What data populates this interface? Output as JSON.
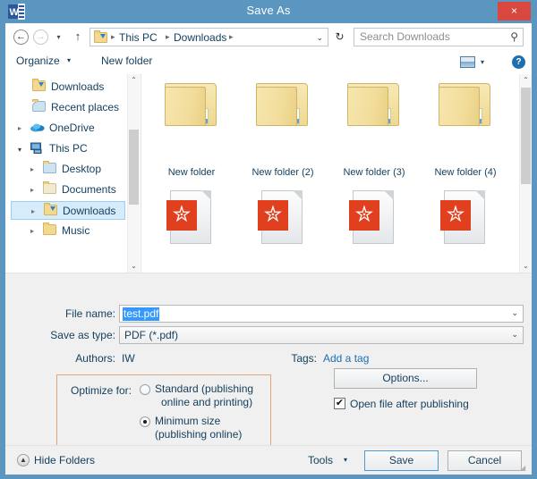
{
  "window": {
    "title": "Save As",
    "app_icon": "word-icon",
    "close_label": "×",
    "titlebar_color": "#5b96c0",
    "close_color": "#d9483e"
  },
  "navbar": {
    "back_glyph": "←",
    "forward_glyph": "→",
    "recent_glyph": "▾",
    "up_glyph": "↑",
    "breadcrumb": [
      "This PC",
      "Downloads"
    ],
    "breadcrumb_sep": "▸",
    "breadcrumb_caret": "⌄",
    "refresh_glyph": "↻",
    "search_placeholder": "Search Downloads",
    "search_value": "",
    "search_icon": "⚲"
  },
  "commandbar": {
    "organize_label": "Organize",
    "organize_caret": "▾",
    "new_folder_label": "New folder",
    "view_caret": "▾",
    "help_label": "?"
  },
  "sidebar": {
    "items": [
      {
        "label": "Downloads",
        "icon": "folder-downloads-icon",
        "indent": 24,
        "expander": "",
        "selected": false
      },
      {
        "label": "Recent places",
        "icon": "recent-places-icon",
        "indent": 24,
        "expander": "",
        "selected": false
      },
      {
        "label": "OneDrive",
        "icon": "onedrive-icon",
        "indent": 22,
        "expander": "▸",
        "selected": false
      },
      {
        "label": "This PC",
        "icon": "this-pc-icon",
        "indent": 22,
        "expander": "▾",
        "selected": false
      },
      {
        "label": "Desktop",
        "icon": "folder-desktop-icon",
        "indent": 36,
        "expander": "▸",
        "selected": false
      },
      {
        "label": "Documents",
        "icon": "folder-documents-icon",
        "indent": 36,
        "expander": "▸",
        "selected": false
      },
      {
        "label": "Downloads",
        "icon": "folder-downloads-icon",
        "indent": 36,
        "expander": "▸",
        "selected": true
      },
      {
        "label": "Music",
        "icon": "folder-music-icon",
        "indent": 36,
        "expander": "▸",
        "selected": false
      }
    ],
    "scroll_up": "⌃",
    "scroll_down": "⌄"
  },
  "filelist": {
    "folders": [
      {
        "name": "New folder"
      },
      {
        "name": "New folder (2)"
      },
      {
        "name": "New folder (3)"
      },
      {
        "name": "New folder (4)"
      }
    ],
    "files": [
      {
        "name": "",
        "icon": "pdf-file-icon",
        "glyph": "✮"
      },
      {
        "name": "",
        "icon": "pdf-file-icon",
        "glyph": "✮"
      },
      {
        "name": "",
        "icon": "pdf-file-icon",
        "glyph": "✮"
      },
      {
        "name": "",
        "icon": "pdf-file-icon",
        "glyph": "✮"
      }
    ],
    "pdf_badge_color": "#e1401f",
    "scroll_up": "⌃",
    "scroll_down": "⌄"
  },
  "form": {
    "filename_label": "File name:",
    "filename_value": "test.pdf",
    "filename_caret": "⌄",
    "savetype_label": "Save as type:",
    "savetype_value": "PDF (*.pdf)",
    "savetype_caret": "⌄",
    "authors_label": "Authors:",
    "authors_value": "IW",
    "tags_label": "Tags:",
    "tags_link": "Add a tag",
    "optimize_label": "Optimize for:",
    "optimize_options": [
      {
        "line1": "Standard (publishing",
        "line2": "online and printing)",
        "selected": false
      },
      {
        "line1": "Minimum size",
        "line2": "(publishing online)",
        "selected": true
      }
    ],
    "highlight_color": "#e0a577",
    "options_button": "Options...",
    "openfile_label": "Open file after publishing",
    "openfile_checked": true,
    "check_glyph": "✔"
  },
  "footer": {
    "hide_folders_label": "Hide Folders",
    "hide_folders_glyph": "▲",
    "tools_label": "Tools",
    "tools_caret": "▾",
    "save_label": "Save",
    "cancel_label": "Cancel",
    "grip_glyph": "◢"
  }
}
